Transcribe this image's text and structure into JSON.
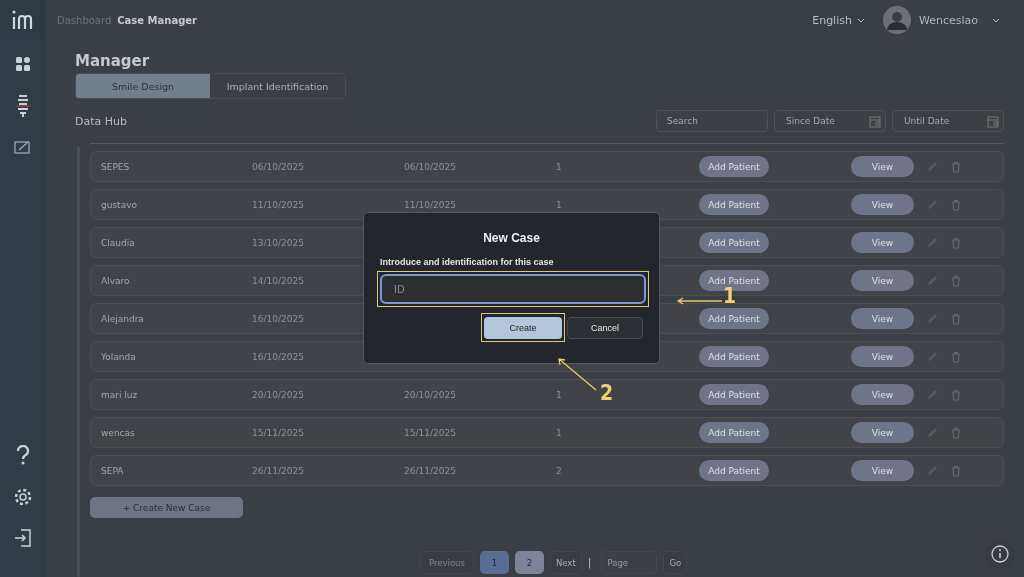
{
  "breadcrumb": [
    {
      "label": "Dashboard",
      "selected": false
    },
    {
      "label": "Case Manager",
      "selected": true
    }
  ],
  "header": {
    "language": "English",
    "user": "Wenceslao"
  },
  "page_title": "Manager",
  "tabs": [
    {
      "label": "Smile Design",
      "selected": true
    },
    {
      "label": "Implant Identification",
      "selected": false
    }
  ],
  "section_title": "Data Hub",
  "filters": {
    "search": {
      "placeholder": "Search"
    },
    "since_date": {
      "placeholder": "Since Date"
    },
    "until_date": {
      "placeholder": "Until Date"
    }
  },
  "rows": [
    {
      "name": "SEPES",
      "created": "06/10/2025",
      "updated": "06/10/2025",
      "count": "1",
      "add_button": "Add Patient",
      "view_button": "View"
    },
    {
      "name": "gustavo",
      "created": "11/10/2025",
      "updated": "11/10/2025",
      "count": "1",
      "add_button": "Add Patient",
      "view_button": "View"
    },
    {
      "name": "Claudia",
      "created": "13/10/2025",
      "add_button": "Add Patient",
      "view_button": "View"
    },
    {
      "name": "Alvaro",
      "created": "14/10/2025",
      "add_button": "Add Patient",
      "view_button": "View"
    },
    {
      "name": "Alejandra",
      "created": "16/10/2025",
      "add_button": "Add Patient",
      "view_button": "View"
    },
    {
      "name": "Yolanda",
      "created": "16/10/2025",
      "add_button": "Add Patient",
      "view_button": "View"
    },
    {
      "name": "mari luz",
      "created": "20/10/2025",
      "updated": "20/10/2025",
      "count": "1",
      "add_button": "Add Patient",
      "view_button": "View"
    },
    {
      "name": "wencas",
      "created": "15/11/2025",
      "updated": "15/11/2025",
      "count": "1",
      "add_button": "Add Patient",
      "view_button": "View"
    },
    {
      "name": "SEPA",
      "created": "26/11/2025",
      "updated": "26/11/2025",
      "count": "2",
      "add_button": "Add Patient",
      "view_button": "View"
    }
  ],
  "create_button": "+ Create New Case",
  "pagination": {
    "previous": {
      "label": "Previous",
      "disabled": true
    },
    "pages": [
      {
        "label": "1",
        "selected": true
      },
      {
        "label": "2",
        "selected": false
      }
    ],
    "next": "Next",
    "separator": "|",
    "page_field": {
      "placeholder": "Page"
    },
    "go": "Go"
  },
  "modal": {
    "title": "New Case",
    "prompt": "Introduce and identification for this case",
    "id_field": {
      "placeholder": "ID"
    },
    "buttons": [
      {
        "label": "Create",
        "kind": "primary"
      },
      {
        "label": "Cancel",
        "kind": "secondary"
      }
    ]
  },
  "annotations": [
    {
      "label": "1"
    },
    {
      "label": "2"
    }
  ]
}
